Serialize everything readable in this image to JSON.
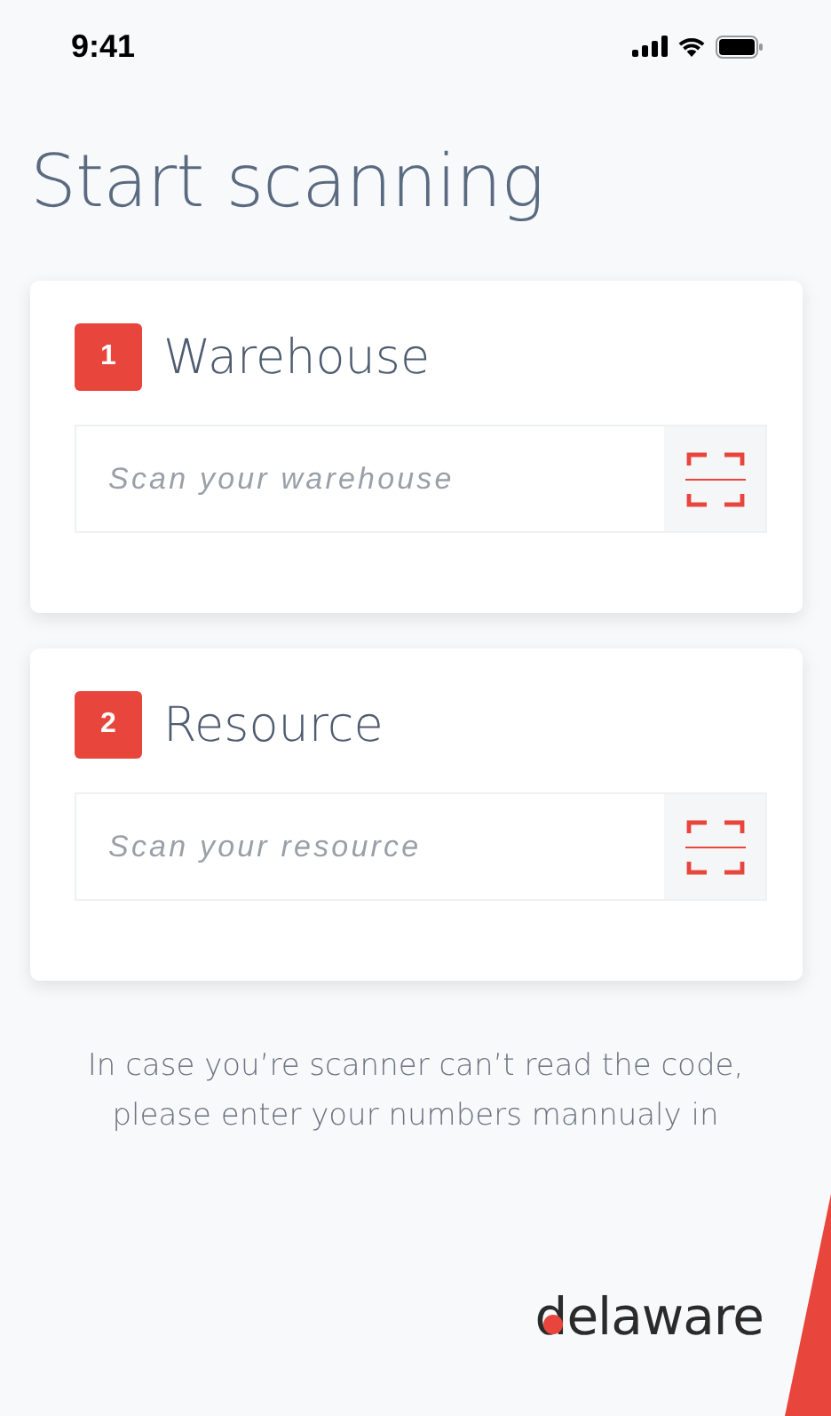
{
  "status_bar": {
    "time": "9:41"
  },
  "title": "Start scanning",
  "steps": [
    {
      "number": "1",
      "label": "Warehouse",
      "placeholder": "Scan your warehouse"
    },
    {
      "number": "2",
      "label": "Resource",
      "placeholder": "Scan your resource"
    }
  ],
  "note": "In case you’re scanner can’t read the code, please enter your numbers mannualy in",
  "logo": "delaware"
}
